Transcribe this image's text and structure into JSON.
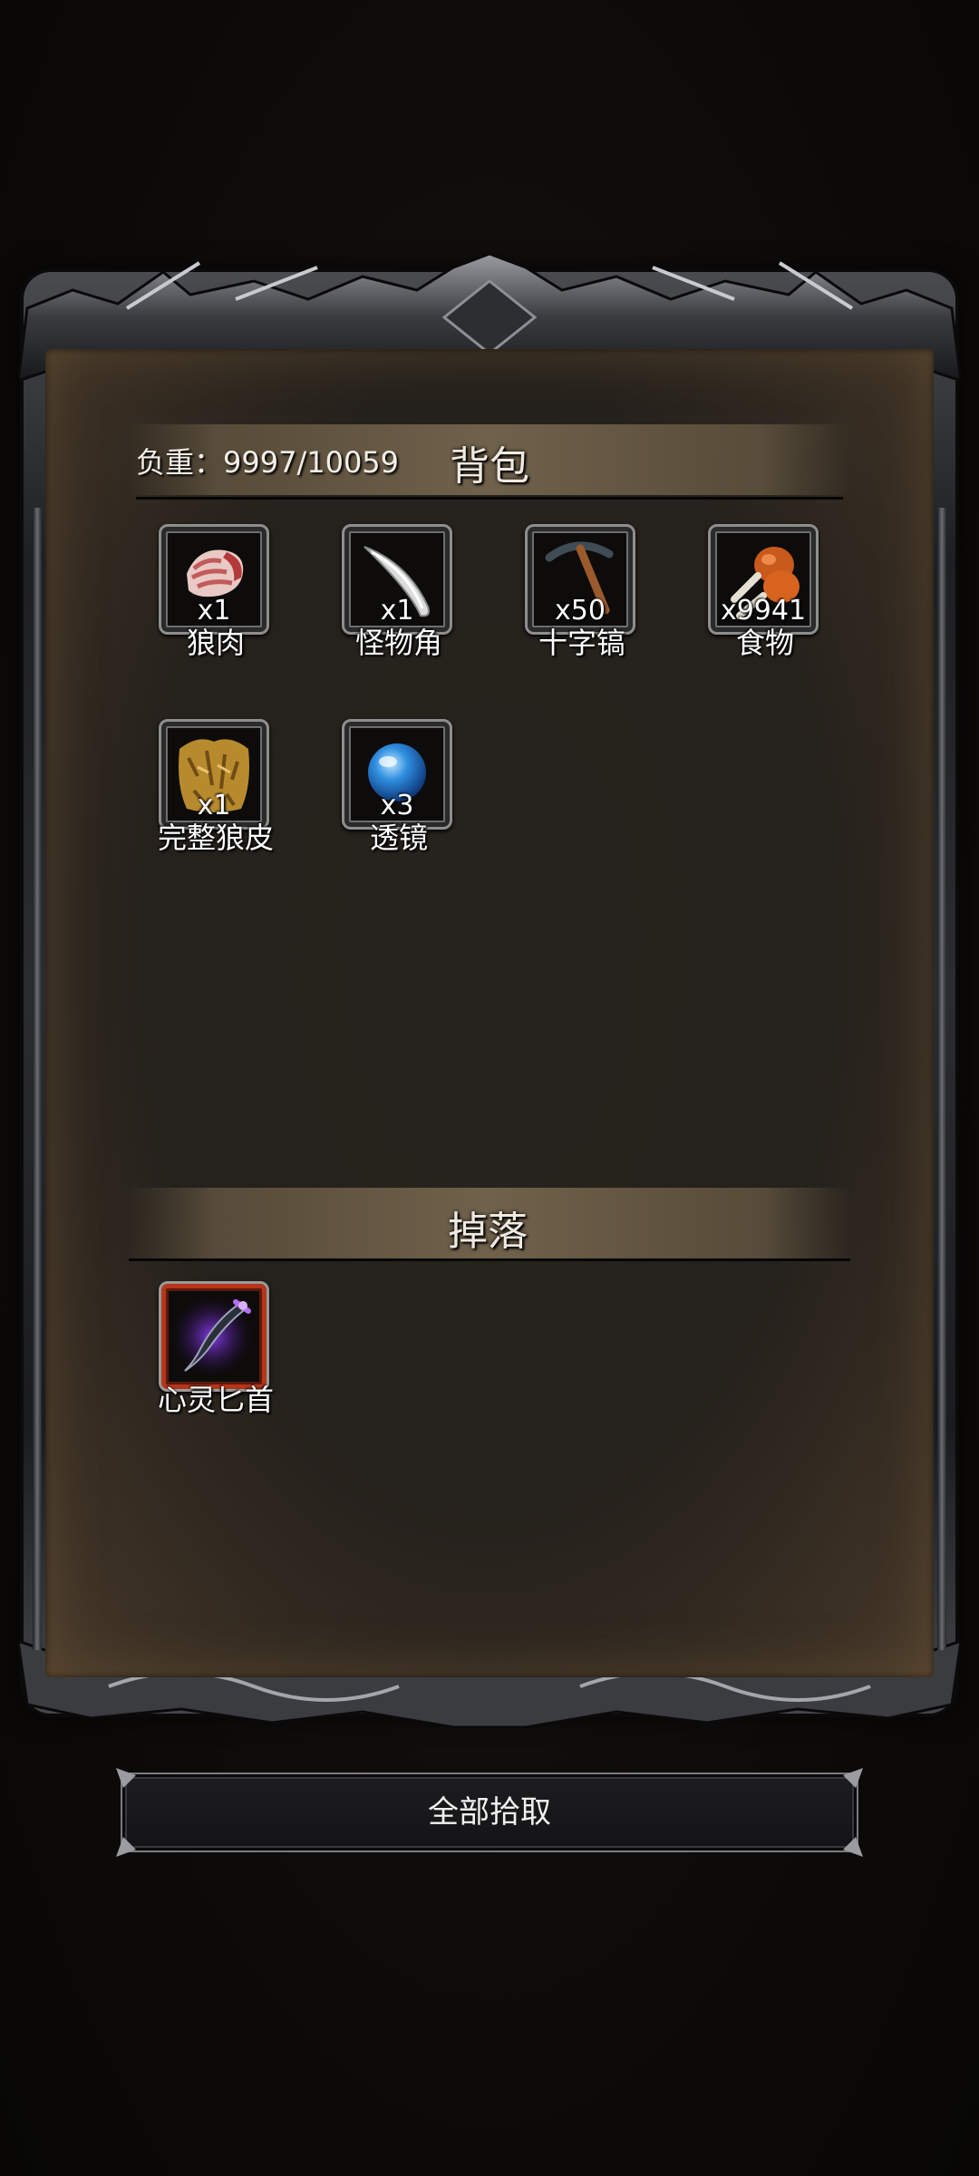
{
  "inventory": {
    "weight_label": "负重：9997/10059",
    "title": "背包",
    "items": [
      {
        "name": "狼肉",
        "qty": "x1",
        "icon": "raw-meat-icon"
      },
      {
        "name": "怪物角",
        "qty": "x1",
        "icon": "monster-horn-icon"
      },
      {
        "name": "十字镐",
        "qty": "x50",
        "icon": "pickaxe-icon"
      },
      {
        "name": "食物",
        "qty": "x9941",
        "icon": "drumstick-icon"
      },
      {
        "name": "完整狼皮",
        "qty": "x1",
        "icon": "wolf-pelt-icon"
      },
      {
        "name": "透镜",
        "qty": "x3",
        "icon": "blue-lens-icon"
      }
    ]
  },
  "drops": {
    "title": "掉落",
    "items": [
      {
        "name": "心灵匕首",
        "icon": "purple-dagger-icon",
        "rarity": "rare"
      }
    ]
  },
  "actions": {
    "pickup_all_label": "全部拾取"
  },
  "colors": {
    "panel": "#25211c",
    "frame": "#2b2c30",
    "rare_border": "#b7351a"
  }
}
